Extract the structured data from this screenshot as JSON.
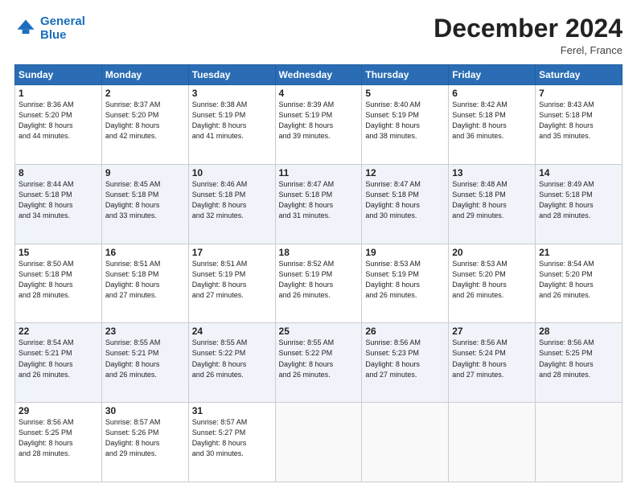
{
  "header": {
    "logo_line1": "General",
    "logo_line2": "Blue",
    "month": "December 2024",
    "location": "Ferel, France"
  },
  "weekdays": [
    "Sunday",
    "Monday",
    "Tuesday",
    "Wednesday",
    "Thursday",
    "Friday",
    "Saturday"
  ],
  "weeks": [
    [
      {
        "day": 1,
        "sunrise": "8:36 AM",
        "sunset": "5:20 PM",
        "daylight": "8 hours and 44 minutes."
      },
      {
        "day": 2,
        "sunrise": "8:37 AM",
        "sunset": "5:20 PM",
        "daylight": "8 hours and 42 minutes."
      },
      {
        "day": 3,
        "sunrise": "8:38 AM",
        "sunset": "5:19 PM",
        "daylight": "8 hours and 41 minutes."
      },
      {
        "day": 4,
        "sunrise": "8:39 AM",
        "sunset": "5:19 PM",
        "daylight": "8 hours and 39 minutes."
      },
      {
        "day": 5,
        "sunrise": "8:40 AM",
        "sunset": "5:19 PM",
        "daylight": "8 hours and 38 minutes."
      },
      {
        "day": 6,
        "sunrise": "8:42 AM",
        "sunset": "5:18 PM",
        "daylight": "8 hours and 36 minutes."
      },
      {
        "day": 7,
        "sunrise": "8:43 AM",
        "sunset": "5:18 PM",
        "daylight": "8 hours and 35 minutes."
      }
    ],
    [
      {
        "day": 8,
        "sunrise": "8:44 AM",
        "sunset": "5:18 PM",
        "daylight": "8 hours and 34 minutes."
      },
      {
        "day": 9,
        "sunrise": "8:45 AM",
        "sunset": "5:18 PM",
        "daylight": "8 hours and 33 minutes."
      },
      {
        "day": 10,
        "sunrise": "8:46 AM",
        "sunset": "5:18 PM",
        "daylight": "8 hours and 32 minutes."
      },
      {
        "day": 11,
        "sunrise": "8:47 AM",
        "sunset": "5:18 PM",
        "daylight": "8 hours and 31 minutes."
      },
      {
        "day": 12,
        "sunrise": "8:47 AM",
        "sunset": "5:18 PM",
        "daylight": "8 hours and 30 minutes."
      },
      {
        "day": 13,
        "sunrise": "8:48 AM",
        "sunset": "5:18 PM",
        "daylight": "8 hours and 29 minutes."
      },
      {
        "day": 14,
        "sunrise": "8:49 AM",
        "sunset": "5:18 PM",
        "daylight": "8 hours and 28 minutes."
      }
    ],
    [
      {
        "day": 15,
        "sunrise": "8:50 AM",
        "sunset": "5:18 PM",
        "daylight": "8 hours and 28 minutes."
      },
      {
        "day": 16,
        "sunrise": "8:51 AM",
        "sunset": "5:18 PM",
        "daylight": "8 hours and 27 minutes."
      },
      {
        "day": 17,
        "sunrise": "8:51 AM",
        "sunset": "5:19 PM",
        "daylight": "8 hours and 27 minutes."
      },
      {
        "day": 18,
        "sunrise": "8:52 AM",
        "sunset": "5:19 PM",
        "daylight": "8 hours and 26 minutes."
      },
      {
        "day": 19,
        "sunrise": "8:53 AM",
        "sunset": "5:19 PM",
        "daylight": "8 hours and 26 minutes."
      },
      {
        "day": 20,
        "sunrise": "8:53 AM",
        "sunset": "5:20 PM",
        "daylight": "8 hours and 26 minutes."
      },
      {
        "day": 21,
        "sunrise": "8:54 AM",
        "sunset": "5:20 PM",
        "daylight": "8 hours and 26 minutes."
      }
    ],
    [
      {
        "day": 22,
        "sunrise": "8:54 AM",
        "sunset": "5:21 PM",
        "daylight": "8 hours and 26 minutes."
      },
      {
        "day": 23,
        "sunrise": "8:55 AM",
        "sunset": "5:21 PM",
        "daylight": "8 hours and 26 minutes."
      },
      {
        "day": 24,
        "sunrise": "8:55 AM",
        "sunset": "5:22 PM",
        "daylight": "8 hours and 26 minutes."
      },
      {
        "day": 25,
        "sunrise": "8:55 AM",
        "sunset": "5:22 PM",
        "daylight": "8 hours and 26 minutes."
      },
      {
        "day": 26,
        "sunrise": "8:56 AM",
        "sunset": "5:23 PM",
        "daylight": "8 hours and 27 minutes."
      },
      {
        "day": 27,
        "sunrise": "8:56 AM",
        "sunset": "5:24 PM",
        "daylight": "8 hours and 27 minutes."
      },
      {
        "day": 28,
        "sunrise": "8:56 AM",
        "sunset": "5:25 PM",
        "daylight": "8 hours and 28 minutes."
      }
    ],
    [
      {
        "day": 29,
        "sunrise": "8:56 AM",
        "sunset": "5:25 PM",
        "daylight": "8 hours and 28 minutes."
      },
      {
        "day": 30,
        "sunrise": "8:57 AM",
        "sunset": "5:26 PM",
        "daylight": "8 hours and 29 minutes."
      },
      {
        "day": 31,
        "sunrise": "8:57 AM",
        "sunset": "5:27 PM",
        "daylight": "8 hours and 30 minutes."
      },
      null,
      null,
      null,
      null
    ]
  ]
}
